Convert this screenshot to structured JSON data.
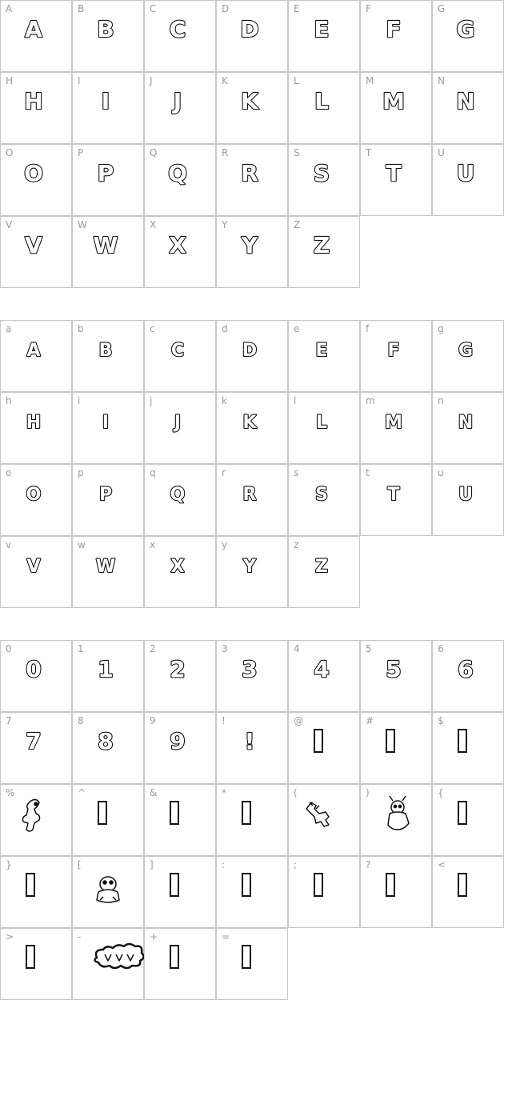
{
  "sections": [
    {
      "name": "uppercase",
      "cells": [
        {
          "key": "A",
          "glyph": "A",
          "kind": "letter"
        },
        {
          "key": "B",
          "glyph": "B",
          "kind": "letter"
        },
        {
          "key": "C",
          "glyph": "C",
          "kind": "letter"
        },
        {
          "key": "D",
          "glyph": "D",
          "kind": "letter"
        },
        {
          "key": "E",
          "glyph": "E",
          "kind": "letter"
        },
        {
          "key": "F",
          "glyph": "F",
          "kind": "letter"
        },
        {
          "key": "G",
          "glyph": "G",
          "kind": "letter"
        },
        {
          "key": "H",
          "glyph": "H",
          "kind": "letter"
        },
        {
          "key": "I",
          "glyph": "I",
          "kind": "letter"
        },
        {
          "key": "J",
          "glyph": "J",
          "kind": "letter"
        },
        {
          "key": "K",
          "glyph": "K",
          "kind": "letter"
        },
        {
          "key": "L",
          "glyph": "L",
          "kind": "letter"
        },
        {
          "key": "M",
          "glyph": "M",
          "kind": "letter"
        },
        {
          "key": "N",
          "glyph": "N",
          "kind": "letter"
        },
        {
          "key": "O",
          "glyph": "O",
          "kind": "letter"
        },
        {
          "key": "P",
          "glyph": "P",
          "kind": "letter"
        },
        {
          "key": "Q",
          "glyph": "Q",
          "kind": "letter"
        },
        {
          "key": "R",
          "glyph": "R",
          "kind": "letter"
        },
        {
          "key": "S",
          "glyph": "S",
          "kind": "letter"
        },
        {
          "key": "T",
          "glyph": "T",
          "kind": "letter"
        },
        {
          "key": "U",
          "glyph": "U",
          "kind": "letter"
        },
        {
          "key": "V",
          "glyph": "V",
          "kind": "letter"
        },
        {
          "key": "W",
          "glyph": "W",
          "kind": "letter"
        },
        {
          "key": "X",
          "glyph": "X",
          "kind": "letter"
        },
        {
          "key": "Y",
          "glyph": "Y",
          "kind": "letter"
        },
        {
          "key": "Z",
          "glyph": "Z",
          "kind": "letter"
        }
      ]
    },
    {
      "name": "lowercase",
      "cells": [
        {
          "key": "a",
          "glyph": "A",
          "kind": "letter-small"
        },
        {
          "key": "b",
          "glyph": "B",
          "kind": "letter-small"
        },
        {
          "key": "c",
          "glyph": "C",
          "kind": "letter-small"
        },
        {
          "key": "d",
          "glyph": "D",
          "kind": "letter-small"
        },
        {
          "key": "e",
          "glyph": "E",
          "kind": "letter-small"
        },
        {
          "key": "f",
          "glyph": "F",
          "kind": "letter-small"
        },
        {
          "key": "g",
          "glyph": "G",
          "kind": "letter-small"
        },
        {
          "key": "h",
          "glyph": "H",
          "kind": "letter-small"
        },
        {
          "key": "i",
          "glyph": "I",
          "kind": "letter-small"
        },
        {
          "key": "j",
          "glyph": "J",
          "kind": "letter-small"
        },
        {
          "key": "k",
          "glyph": "K",
          "kind": "letter-small"
        },
        {
          "key": "l",
          "glyph": "L",
          "kind": "letter-small"
        },
        {
          "key": "m",
          "glyph": "M",
          "kind": "letter-small"
        },
        {
          "key": "n",
          "glyph": "N",
          "kind": "letter-small"
        },
        {
          "key": "o",
          "glyph": "O",
          "kind": "letter-small"
        },
        {
          "key": "p",
          "glyph": "P",
          "kind": "letter-small"
        },
        {
          "key": "q",
          "glyph": "Q",
          "kind": "letter-small"
        },
        {
          "key": "r",
          "glyph": "R",
          "kind": "letter-small"
        },
        {
          "key": "s",
          "glyph": "S",
          "kind": "letter-small"
        },
        {
          "key": "t",
          "glyph": "T",
          "kind": "letter-small"
        },
        {
          "key": "u",
          "glyph": "U",
          "kind": "letter-small"
        },
        {
          "key": "v",
          "glyph": "V",
          "kind": "letter-small"
        },
        {
          "key": "w",
          "glyph": "W",
          "kind": "letter-small"
        },
        {
          "key": "x",
          "glyph": "X",
          "kind": "letter-small"
        },
        {
          "key": "y",
          "glyph": "Y",
          "kind": "letter-small"
        },
        {
          "key": "z",
          "glyph": "Z",
          "kind": "letter-small"
        }
      ]
    },
    {
      "name": "numbers-symbols",
      "cells": [
        {
          "key": "0",
          "glyph": "0",
          "kind": "letter"
        },
        {
          "key": "1",
          "glyph": "1",
          "kind": "letter"
        },
        {
          "key": "2",
          "glyph": "2",
          "kind": "letter"
        },
        {
          "key": "3",
          "glyph": "3",
          "kind": "letter"
        },
        {
          "key": "4",
          "glyph": "4",
          "kind": "letter"
        },
        {
          "key": "5",
          "glyph": "5",
          "kind": "letter"
        },
        {
          "key": "6",
          "glyph": "6",
          "kind": "letter"
        },
        {
          "key": "7",
          "glyph": "7",
          "kind": "letter"
        },
        {
          "key": "8",
          "glyph": "8",
          "kind": "letter"
        },
        {
          "key": "9",
          "glyph": "9",
          "kind": "letter"
        },
        {
          "key": "!",
          "glyph": "!",
          "kind": "letter"
        },
        {
          "key": "@",
          "glyph": "",
          "kind": "notdef"
        },
        {
          "key": "#",
          "glyph": "",
          "kind": "notdef"
        },
        {
          "key": "$",
          "glyph": "",
          "kind": "notdef"
        },
        {
          "key": "%",
          "glyph": "",
          "kind": "picture-figure"
        },
        {
          "key": "^",
          "glyph": "",
          "kind": "notdef"
        },
        {
          "key": "&",
          "glyph": "",
          "kind": "notdef"
        },
        {
          "key": "*",
          "glyph": "",
          "kind": "notdef"
        },
        {
          "key": "(",
          "glyph": "",
          "kind": "picture-arm"
        },
        {
          "key": ")",
          "glyph": "",
          "kind": "picture-character"
        },
        {
          "key": "{",
          "glyph": "",
          "kind": "notdef"
        },
        {
          "key": "}",
          "glyph": "",
          "kind": "notdef"
        },
        {
          "key": "[",
          "glyph": "",
          "kind": "picture-creature"
        },
        {
          "key": "]",
          "glyph": "",
          "kind": "notdef"
        },
        {
          "key": ":",
          "glyph": "",
          "kind": "notdef"
        },
        {
          "key": ";",
          "glyph": "",
          "kind": "notdef"
        },
        {
          "key": "?",
          "glyph": "",
          "kind": "notdef"
        },
        {
          "key": "<",
          "glyph": "",
          "kind": "notdef"
        },
        {
          "key": ">",
          "glyph": "",
          "kind": "notdef"
        },
        {
          "key": "-",
          "glyph": "",
          "kind": "picture-cloud-word"
        },
        {
          "key": "+",
          "glyph": "",
          "kind": "notdef"
        },
        {
          "key": "=",
          "glyph": "",
          "kind": "notdef"
        }
      ]
    }
  ]
}
